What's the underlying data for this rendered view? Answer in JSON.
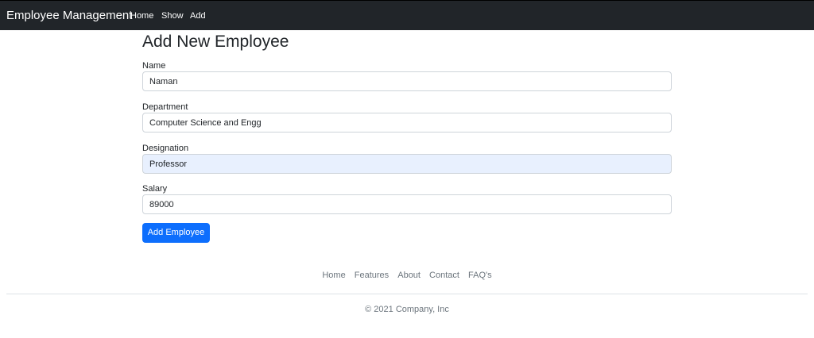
{
  "navbar": {
    "brand": "Employee Management",
    "links": [
      "Home",
      "Show",
      "Add"
    ]
  },
  "form": {
    "title": "Add New Employee",
    "fields": [
      {
        "label": "Name",
        "value": "Naman"
      },
      {
        "label": "Department",
        "value": "Computer Science and Engg"
      },
      {
        "label": "Designation",
        "value": "Professor"
      },
      {
        "label": "Salary",
        "value": "89000"
      }
    ],
    "submit_label": "Add Employee"
  },
  "footer": {
    "links": [
      "Home",
      "Features",
      "About",
      "Contact",
      "FAQ's"
    ],
    "copyright": "© 2021 Company, Inc"
  },
  "colors": {
    "navbar_bg": "#212529",
    "primary": "#0d6efd",
    "muted": "#6c757d",
    "autofill_bg": "#e8f0fe"
  }
}
